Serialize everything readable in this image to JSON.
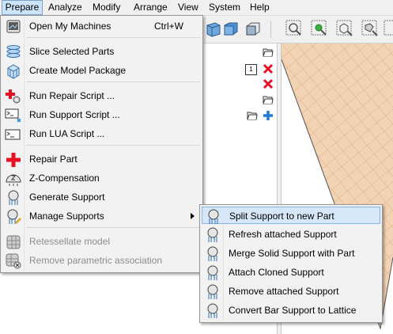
{
  "menubar": {
    "items": [
      "Prepare",
      "Analyze",
      "Modify",
      "Arrange",
      "View",
      "System",
      "Help"
    ]
  },
  "prepare_menu": {
    "items": [
      {
        "label": "Open My Machines",
        "shortcut": "Ctrl+W",
        "icon": "machines-icon"
      },
      {
        "label": "Slice Selected Parts",
        "icon": "slice-icon"
      },
      {
        "label": "Create Model Package",
        "icon": "package-icon"
      },
      {
        "label": "Run Repair Script ...",
        "icon": "repair-script-icon"
      },
      {
        "label": "Run Support Script ...",
        "icon": "support-script-icon"
      },
      {
        "label": "Run LUA Script ...",
        "icon": "lua-script-icon"
      },
      {
        "label": "Repair Part",
        "icon": "repair-cross-icon"
      },
      {
        "label": "Z-Compensation",
        "icon": "z-compensation-icon"
      },
      {
        "label": "Generate Support",
        "icon": "generate-support-icon"
      },
      {
        "label": "Manage Supports",
        "icon": "manage-supports-icon"
      },
      {
        "label": "Retessellate model",
        "icon": "retessellate-icon",
        "disabled": true
      },
      {
        "label": "Remove parametric association",
        "icon": "remove-parametric-icon",
        "disabled": true
      }
    ]
  },
  "manage_supports_submenu": {
    "items": [
      {
        "label": "Split Support to new Part"
      },
      {
        "label": "Refresh attached Support"
      },
      {
        "label": "Merge Solid Support with Part"
      },
      {
        "label": "Attach Cloned Support"
      },
      {
        "label": "Remove attached Support"
      },
      {
        "label": "Convert Bar Support to Lattice"
      }
    ]
  },
  "tree": {
    "badge": "1"
  },
  "colors": {
    "highlight": "#d5e7f8",
    "platform": "#f2d3b3",
    "red": "#e81123",
    "blue": "#1f7ad8"
  }
}
